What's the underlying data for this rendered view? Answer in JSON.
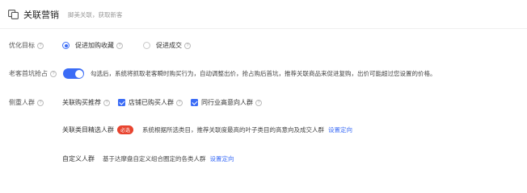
{
  "header": {
    "title": "关联营销",
    "subtitle": "脚美关联，获取新客"
  },
  "optimize_goal": {
    "label": "优化目标",
    "options": [
      {
        "label": "促进加购收藏",
        "selected": true
      },
      {
        "label": "促进成交",
        "selected": false
      }
    ]
  },
  "old_customer": {
    "label": "老客首坑抢占",
    "enabled": true,
    "description": "勾选后，系统将抓取老客瞬时购买行为，自动调整出价，抢占购后首坑，推荐关联商品来促进复购，出价可能超过您设置的价格。"
  },
  "focus_crowd": {
    "label": "侧重人群",
    "related_buy": {
      "label": "关联购买推荐",
      "checks": [
        {
          "label": "店铺已购买人群",
          "checked": true
        },
        {
          "label": "同行业高意向人群",
          "checked": true
        }
      ]
    },
    "category_select": {
      "label": "关联类目精选人群",
      "badge": "必选",
      "description": "系统根据所选类目，推荐关联度最高的叶子类目的高意向及成交人群",
      "link": "设置定向"
    },
    "custom": {
      "label": "自定义人群",
      "description": "基于达摩盘自定义组合圈定的各类人群",
      "link": "设置定向"
    }
  },
  "colors": {
    "accent": "#3b6cf6",
    "badge": "#e8432e"
  },
  "icons": {
    "help": "?"
  }
}
